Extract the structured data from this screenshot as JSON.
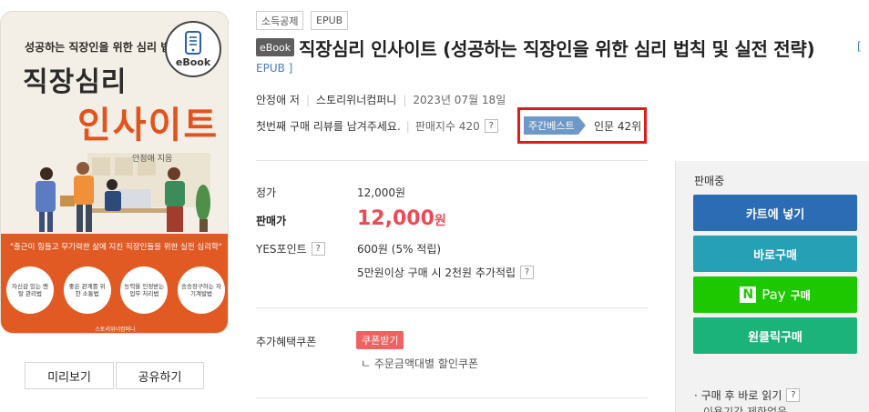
{
  "cover": {
    "sub_title": "성공하는 직장인을 위한 심리 법칙 및",
    "title_line1": "직장심리",
    "title_line2": "인사이트",
    "author_tag": "안정애 지음",
    "band_text": "\"출근이 힘들고 무기력한 삶에 지친 직장인들을 위한 실전 심리학\"",
    "circles": [
      "자신감 있는 멘탈 관리법",
      "좋은 관계를 위한 소통법",
      "능력을 인정받는 업무 처리법",
      "승승장구하는 자기계발법"
    ],
    "publisher": "스토리위너컴퍼니",
    "ebook_badge": "eBook"
  },
  "cover_buttons": {
    "preview": "미리보기",
    "share": "공유하기"
  },
  "tags": [
    "소득공제",
    "EPUB"
  ],
  "ebook_chip": "eBook",
  "title": "직장심리 인사이트 (성공하는 직장인을 위한 심리 법칙 및 실전 전략)",
  "format_part1": "[",
  "format_part2": "EPUB ]",
  "meta": {
    "author": "안정애 저",
    "publisher": "스토리위너컴퍼니",
    "date": "2023년 07월 18일"
  },
  "review": {
    "prompt": "첫번째 구매 리뷰를 남겨주세요.",
    "sales_index": "판매지수 420",
    "help": "?"
  },
  "best": {
    "tag": "주간베스트",
    "rank": "인문 42위"
  },
  "price": {
    "list_label": "정가",
    "list_value": "12,000원",
    "sale_label": "판매가",
    "sale_value": "12,000",
    "sale_unit": "원",
    "points_label": "YES포인트",
    "points_value": "600원 (5% 적립)",
    "points_extra": "5만원이상 구매 시 2천원 추가적립"
  },
  "coupon": {
    "label": "추가혜택쿠폰",
    "button": "쿠폰받기",
    "sub": "ㄴ 주문금액대별 할인쿠폰"
  },
  "panel": {
    "status": "판매중",
    "cart": "카트에 넣기",
    "buy_now": "바로구매",
    "npay_icon": "N",
    "npay_word": "Pay",
    "npay_buy": "구매",
    "one_click": "원클릭구매",
    "foot1": "· 구매 후 바로 읽기",
    "foot2": "이용기간 제한없음"
  }
}
